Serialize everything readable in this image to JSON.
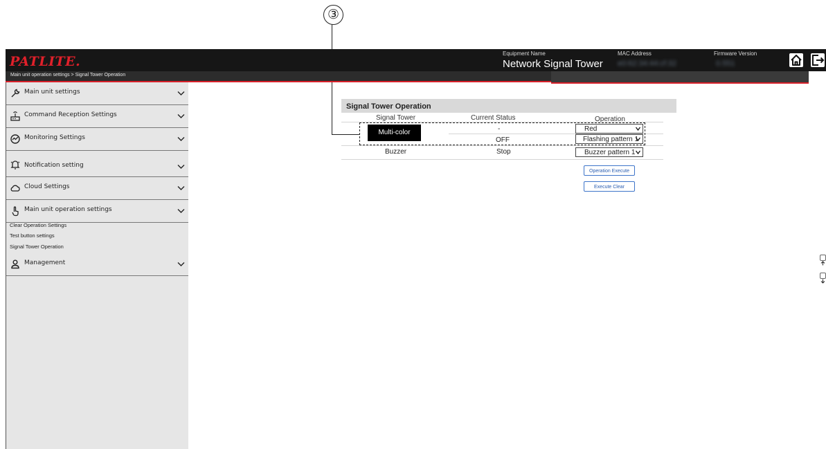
{
  "callout": {
    "number": "③"
  },
  "header": {
    "logo": "PATLITE.",
    "equipment_caption": "Equipment Name",
    "equipment_value": "Network Signal Tower",
    "mac_caption": "MAC Address",
    "mac_value": "e0:62:34:44:cf:32",
    "firmware_caption": "Firmware Version",
    "firmware_value": "0.551",
    "home_icon": "home-icon",
    "logout_icon": "logout-icon"
  },
  "breadcrumb": "Main unit operation settings > Signal Tower Operation",
  "sidebar": {
    "items": [
      {
        "label": "Main unit settings",
        "icon": "wrench-icon"
      },
      {
        "label": "Command Reception Settings",
        "icon": "command-reception-icon"
      },
      {
        "label": "Monitoring Settings",
        "icon": "monitoring-icon"
      },
      {
        "label": "Notification setting",
        "icon": "bell-icon"
      },
      {
        "label": "Cloud Settings",
        "icon": "cloud-icon"
      },
      {
        "label": "Main unit operation settings",
        "icon": "hand-pointer-icon"
      }
    ],
    "subitems": [
      "Clear Operation Settings",
      "Test button settings",
      "Signal Tower Operation"
    ],
    "management": {
      "label": "Management",
      "icon": "user-icon"
    }
  },
  "panel": {
    "title": "Signal Tower Operation",
    "columns": [
      "Signal Tower",
      "Current Status",
      "Operation"
    ],
    "tower_label": "Multi-color",
    "status_color": "-",
    "status_pattern": "OFF",
    "select_color": "Red",
    "select_pattern": "Flashing pattern 1",
    "buzzer_label": "Buzzer",
    "buzzer_status": "Stop",
    "select_buzzer": "Buzzer pattern 1",
    "execute_button": "Operation Execute",
    "clear_button": "Execute Clear"
  },
  "colors": {
    "accent_red": "#d9202a",
    "logo_red": "#e0202a",
    "button_blue": "#3d74c9"
  }
}
